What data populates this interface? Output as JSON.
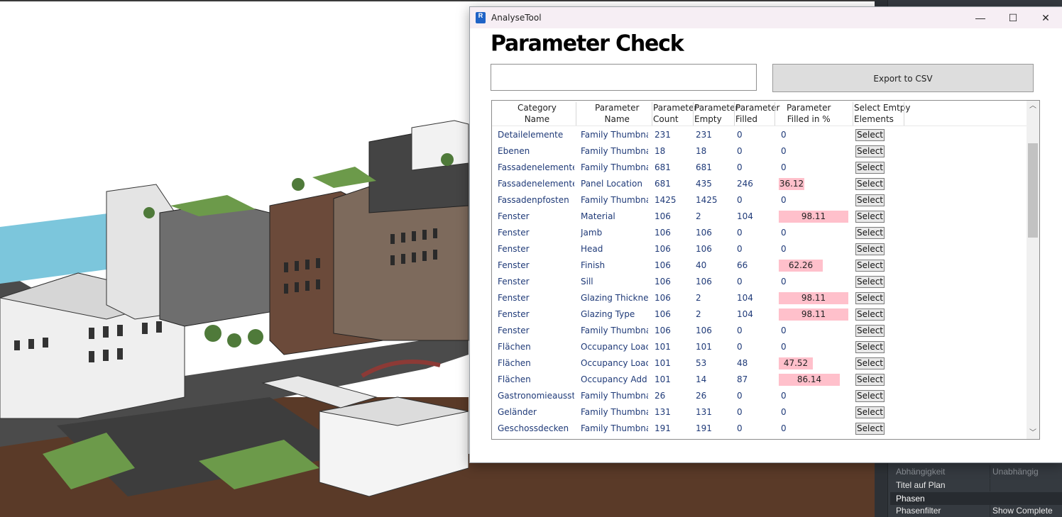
{
  "window": {
    "app_title": "AnalyseTool",
    "heading": "Parameter Check",
    "search": {
      "value": ""
    },
    "export_button": "Export to CSV",
    "minimize_glyph": "—",
    "maximize_glyph": "☐",
    "close_glyph": "✕",
    "app_icon": "R"
  },
  "grid": {
    "headers": {
      "category": "Category\nName",
      "parameter": "Parameter\nName",
      "count": "Parameter\nCount",
      "empty": "Parameter\nEmpty",
      "filled": "Parameter\nFilled",
      "pct": "Parameter\nFilled in %",
      "select": "Select Emtpy\nElements"
    },
    "select_label": "Select",
    "bar_color": "#ffc0cb",
    "rows": [
      {
        "category": "Detailelemente",
        "parameter": "Family Thumbnail",
        "count": "231",
        "empty": "231",
        "filled": "0",
        "pct": "0"
      },
      {
        "category": "Ebenen",
        "parameter": "Family Thumbnail",
        "count": "18",
        "empty": "18",
        "filled": "0",
        "pct": "0"
      },
      {
        "category": "Fassadenelemente",
        "parameter": "Family Thumbnail",
        "count": "681",
        "empty": "681",
        "filled": "0",
        "pct": "0"
      },
      {
        "category": "Fassadenelemente",
        "parameter": "Panel Location",
        "count": "681",
        "empty": "435",
        "filled": "246",
        "pct": "36.12"
      },
      {
        "category": "Fassadenpfosten",
        "parameter": "Family Thumbnail",
        "count": "1425",
        "empty": "1425",
        "filled": "0",
        "pct": "0"
      },
      {
        "category": "Fenster",
        "parameter": "Material",
        "count": "106",
        "empty": "2",
        "filled": "104",
        "pct": "98.11"
      },
      {
        "category": "Fenster",
        "parameter": "Jamb",
        "count": "106",
        "empty": "106",
        "filled": "0",
        "pct": "0"
      },
      {
        "category": "Fenster",
        "parameter": "Head",
        "count": "106",
        "empty": "106",
        "filled": "0",
        "pct": "0"
      },
      {
        "category": "Fenster",
        "parameter": "Finish",
        "count": "106",
        "empty": "40",
        "filled": "66",
        "pct": "62.26"
      },
      {
        "category": "Fenster",
        "parameter": "Sill",
        "count": "106",
        "empty": "106",
        "filled": "0",
        "pct": "0"
      },
      {
        "category": "Fenster",
        "parameter": "Glazing Thickness",
        "count": "106",
        "empty": "2",
        "filled": "104",
        "pct": "98.11"
      },
      {
        "category": "Fenster",
        "parameter": "Glazing Type",
        "count": "106",
        "empty": "2",
        "filled": "104",
        "pct": "98.11"
      },
      {
        "category": "Fenster",
        "parameter": "Family Thumbnail",
        "count": "106",
        "empty": "106",
        "filled": "0",
        "pct": "0"
      },
      {
        "category": "Flächen",
        "parameter": "Occupancy Load",
        "count": "101",
        "empty": "101",
        "filled": "0",
        "pct": "0"
      },
      {
        "category": "Flächen",
        "parameter": "Occupancy Load F",
        "count": "101",
        "empty": "53",
        "filled": "48",
        "pct": "47.52"
      },
      {
        "category": "Flächen",
        "parameter": "Occupancy Add C",
        "count": "101",
        "empty": "14",
        "filled": "87",
        "pct": "86.14"
      },
      {
        "category": "Gastronomieausstat",
        "parameter": "Family Thumbnail",
        "count": "26",
        "empty": "26",
        "filled": "0",
        "pct": "0"
      },
      {
        "category": "Geländer",
        "parameter": "Family Thumbnail",
        "count": "131",
        "empty": "131",
        "filled": "0",
        "pct": "0"
      },
      {
        "category": "Geschossdecken",
        "parameter": "Family Thumbnail",
        "count": "191",
        "empty": "191",
        "filled": "0",
        "pct": "0"
      }
    ]
  },
  "properties_panel": {
    "rows": [
      {
        "key": "Abhängigkeit",
        "value": "Unabhängig",
        "style": "dim"
      },
      {
        "key": "Titel auf Plan",
        "value": "",
        "style": "norm"
      },
      {
        "key": "Phasen",
        "value": "",
        "style": "head"
      },
      {
        "key": "Phasenfilter",
        "value": "Show Complete",
        "style": "norm"
      }
    ]
  }
}
